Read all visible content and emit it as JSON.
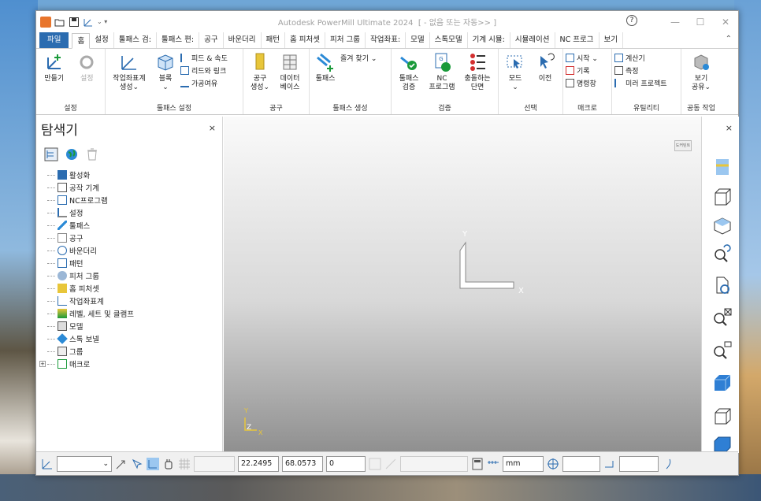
{
  "app": {
    "title": "Autodesk PowerMill Ultimate 2024",
    "doc_suffix": "[ - 없음 또는 자동>> ]",
    "help": "?",
    "min": "—",
    "max": "☐",
    "close": "✕"
  },
  "tabs": [
    "파일",
    "홈",
    "설정",
    "툴패스 검:",
    "툴패스 편:",
    "공구",
    "바운더리",
    "패턴",
    "홈 피처셋",
    "피처 그룹",
    "작업좌표:",
    "모델",
    "스톡모델",
    "기계 시뮬:",
    "시뮬레이션",
    "NC 프로그",
    "보기"
  ],
  "active_tab": "홈",
  "ribbon": {
    "groups": [
      {
        "label": "설정",
        "big": [
          {
            "label": "만들기"
          },
          {
            "label": "설정",
            "disabled": true
          }
        ]
      },
      {
        "label": "툴패스 설정",
        "big": [
          {
            "label": "작업좌표계\n생성⌄"
          },
          {
            "label": "블록\n⌄"
          }
        ],
        "small": [
          "피드 & 속도",
          "리드와 링크",
          "가공여유"
        ]
      },
      {
        "label": "공구",
        "big": [
          {
            "label": "공구\n생성⌄"
          },
          {
            "label": "데이터\n베이스"
          }
        ]
      },
      {
        "label": "툴패스 생성",
        "big": [
          {
            "label": "툴패스"
          }
        ],
        "small": [
          "즐겨 찾기 ⌄"
        ]
      },
      {
        "label": "검증",
        "big": [
          {
            "label": "툴패스\n검증"
          },
          {
            "label": "NC\n프로그램"
          },
          {
            "label": "충돌하는\n단면"
          }
        ]
      },
      {
        "label": "선택",
        "big": [
          {
            "label": "모드\n⌄"
          },
          {
            "label": "이전"
          }
        ]
      },
      {
        "label": "매크로",
        "small": [
          "시작 ⌄",
          "기록",
          "명령창"
        ]
      },
      {
        "label": "유틸리티",
        "small": [
          "계산기",
          "측정",
          "미러 프로젝트"
        ]
      },
      {
        "label": "공동 작업",
        "big": [
          {
            "label": "보기\n공유⌄"
          }
        ]
      }
    ]
  },
  "explorer": {
    "title": "탐색기",
    "close": "×",
    "items": [
      "활성화",
      "공작 기계",
      "NC프로그램",
      "설정",
      "툴패스",
      "공구",
      "바운더리",
      "패턴",
      "피처 그룹",
      "홈 피처셋",
      "작업좌표계",
      "레벨, 세트 및 클램프",
      "모델",
      "스톡 보넬",
      "그룹",
      "매크로"
    ]
  },
  "viewport": {
    "axis_x": "X",
    "axis_y": "Y",
    "mini_x": "X",
    "mini_y": "Y",
    "mini_z": "Z",
    "badge": "도커틴트"
  },
  "right_bar": {
    "close": "×"
  },
  "statusbar": {
    "coord_x": "22.2495",
    "coord_y": "68.0573",
    "coord_z": "0",
    "unit": "mm"
  },
  "colors": {
    "accent": "#2b6cb0",
    "file_tab": "#2b6cb0",
    "view_cube": "#2f7fd4"
  }
}
